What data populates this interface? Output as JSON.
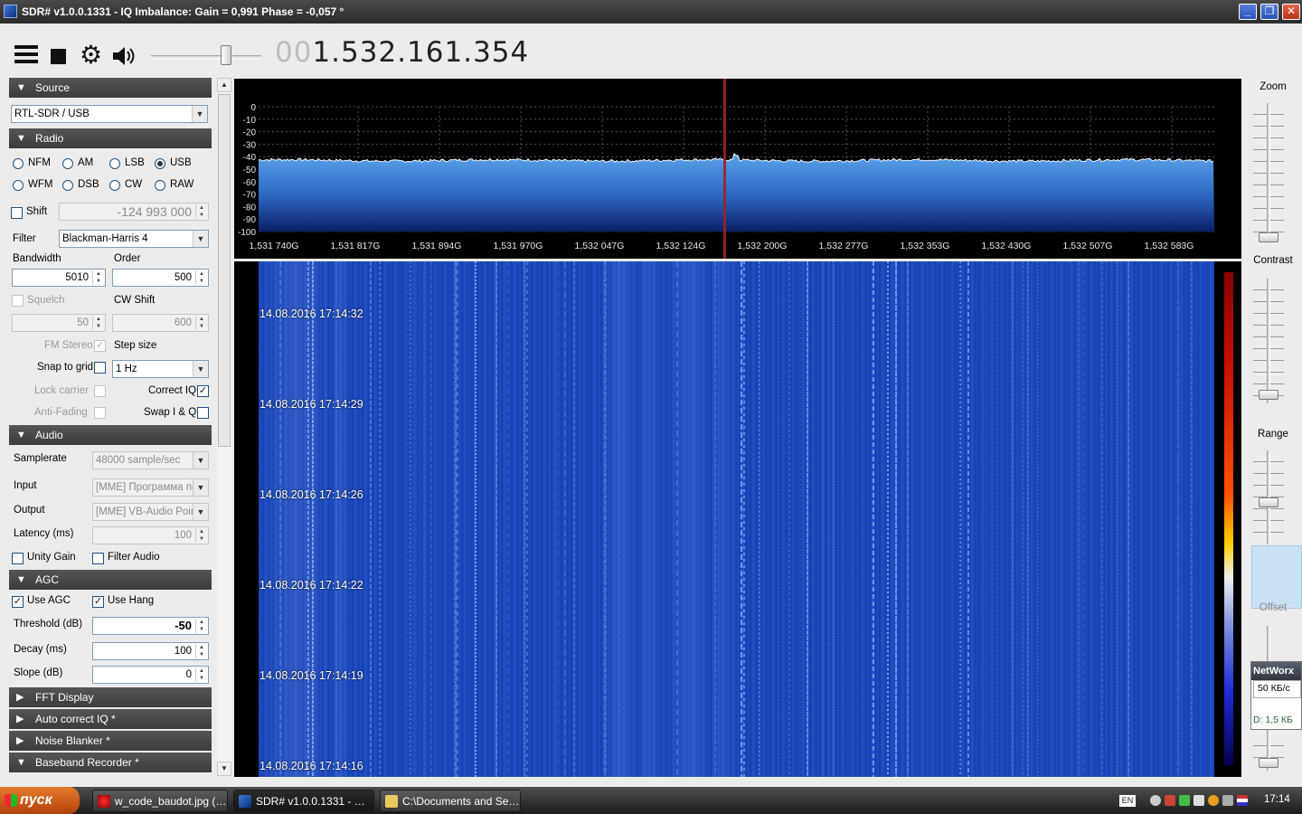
{
  "window": {
    "title": "SDR# v1.0.0.1331 - IQ Imbalance: Gain = 0,991 Phase = -0,057 °",
    "min_label": "_",
    "max_label": "❐",
    "close_label": "✕"
  },
  "toolbar": {
    "frequency_leading": "00",
    "frequency_main": "1.532.161.354",
    "volume_level_percent": 70
  },
  "source": {
    "header": "Source",
    "device": "RTL-SDR / USB"
  },
  "radio": {
    "header": "Radio",
    "modes": [
      "NFM",
      "AM",
      "LSB",
      "USB",
      "WFM",
      "DSB",
      "CW",
      "RAW"
    ],
    "selected_mode": "USB",
    "shift_label": "Shift",
    "shift_value": "-124 993 000",
    "filter_label": "Filter",
    "filter_value": "Blackman-Harris 4",
    "bandwidth_label": "Bandwidth",
    "bandwidth_value": "5010",
    "order_label": "Order",
    "order_value": "500",
    "squelch_label": "Squelch",
    "squelch_value": "50",
    "cw_shift_label": "CW Shift",
    "cw_shift_value": "600",
    "fm_stereo_label": "FM Stereo",
    "step_size_label": "Step size",
    "snap_label": "Snap to grid",
    "step_value": "1 Hz",
    "lock_carrier_label": "Lock carrier",
    "correct_iq_label": "Correct IQ",
    "anti_fading_label": "Anti-Fading",
    "swap_iq_label": "Swap I & Q"
  },
  "audio": {
    "header": "Audio",
    "samplerate_label": "Samplerate",
    "samplerate_value": "48000 sample/sec",
    "input_label": "Input",
    "input_value": "[MME] Программа пе",
    "output_label": "Output",
    "output_value": "[MME] VB-Audio Point",
    "latency_label": "Latency (ms)",
    "latency_value": "100",
    "unity_gain_label": "Unity Gain",
    "filter_audio_label": "Filter Audio"
  },
  "agc": {
    "header": "AGC",
    "use_agc_label": "Use AGC",
    "use_hang_label": "Use Hang",
    "threshold_label": "Threshold (dB)",
    "threshold_value": "-50",
    "decay_label": "Decay (ms)",
    "decay_value": "100",
    "slope_label": "Slope (dB)",
    "slope_value": "0"
  },
  "collapsed_sections": [
    "FFT Display",
    "Auto correct IQ *",
    "Noise Blanker *",
    "Baseband Recorder *"
  ],
  "spectrum": {
    "y_ticks": [
      "0",
      "-10",
      "-20",
      "-30",
      "-40",
      "-50",
      "-60",
      "-70",
      "-80",
      "-90",
      "-100"
    ],
    "x_ticks": [
      "1,531 740G",
      "1,531 817G",
      "1,531 894G",
      "1,531 970G",
      "1,532 047G",
      "1,532 124G",
      "1,532 200G",
      "1,532 277G",
      "1,532 353G",
      "1,532 430G",
      "1,532 507G",
      "1,532 583G"
    ],
    "noise_floor_db": -43
  },
  "waterfall": {
    "timestamps": [
      "14.08.2016 17:14:32",
      "14.08.2016 17:14:29",
      "14.08.2016 17:14:26",
      "14.08.2016 17:14:22",
      "14.08.2016 17:14:19",
      "14.08.2016 17:14:16"
    ]
  },
  "right_panel": {
    "zoom_label": "Zoom",
    "contrast_label": "Contrast",
    "range_label": "Range",
    "offset_label": "Offset"
  },
  "networx": {
    "title": "NetWorx",
    "rate": "50 КБ/с",
    "download": "D: 1,5 КБ"
  },
  "taskbar": {
    "start_label": "пуск",
    "tasks": [
      "w_code_baudot.jpg (…",
      "SDR# v1.0.0.1331 - …",
      "C:\\Documents and Se…"
    ],
    "language": "EN",
    "clock": "17:14"
  },
  "colors": {
    "spectrum_fill": "#3a7fd0",
    "waterfall_base": "#1b45b8",
    "vfo_marker": "#a02020"
  }
}
